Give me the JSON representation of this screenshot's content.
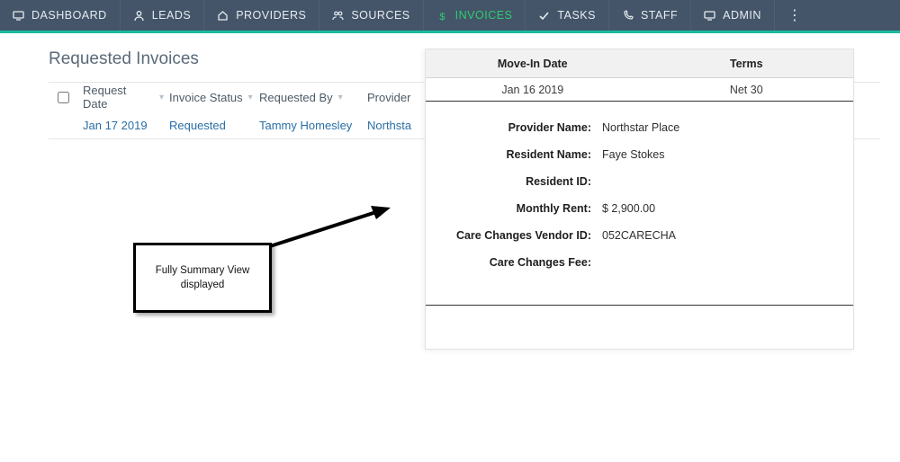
{
  "nav": [
    {
      "label": "DASHBOARD",
      "icon": "monitor"
    },
    {
      "label": "LEADS",
      "icon": "user"
    },
    {
      "label": "PROVIDERS",
      "icon": "home"
    },
    {
      "label": "SOURCES",
      "icon": "people"
    },
    {
      "label": "INVOICES",
      "icon": "dollar",
      "active": true
    },
    {
      "label": "TASKS",
      "icon": "check"
    },
    {
      "label": "STAFF",
      "icon": "phone"
    },
    {
      "label": "ADMIN",
      "icon": "monitor"
    }
  ],
  "page_title": "Requested Invoices",
  "columns": {
    "request_date": "Request Date",
    "invoice_status": "Invoice Status",
    "requested_by": "Requested By",
    "provider": "Provider"
  },
  "rows": [
    {
      "request_date": "Jan 17 2019",
      "invoice_status": "Requested",
      "requested_by": "Tammy Homesley",
      "provider": "Northsta"
    }
  ],
  "summary": {
    "head": {
      "movein": "Move-In Date",
      "terms": "Terms"
    },
    "row": {
      "movein": "Jan 16 2019",
      "terms": "Net 30"
    },
    "fields": {
      "provider_name": {
        "k": "Provider Name:",
        "v": "Northstar Place"
      },
      "resident_name": {
        "k": "Resident Name:",
        "v": "Faye Stokes"
      },
      "resident_id": {
        "k": "Resident ID:",
        "v": ""
      },
      "monthly_rent": {
        "k": "Monthly Rent:",
        "v": "$ 2,900.00"
      },
      "vendor_id": {
        "k": "Care Changes Vendor ID:",
        "v": "052CARECHA"
      },
      "fee": {
        "k": "Care Changes Fee:",
        "v": ""
      }
    }
  },
  "callout_text": "Fully Summary View displayed"
}
